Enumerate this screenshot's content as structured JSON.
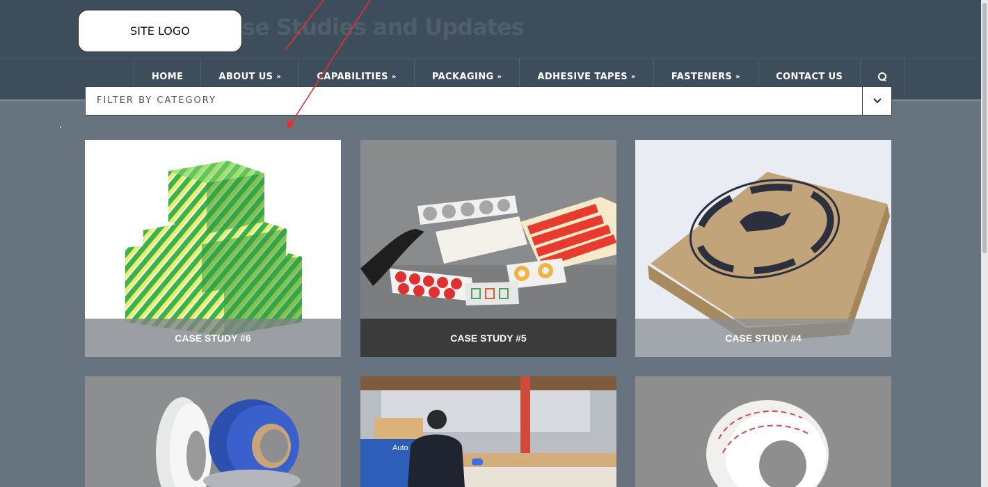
{
  "header": {
    "bg_title": "Case Studies and Updates",
    "logo_text": "SITE LOGO"
  },
  "nav": {
    "items": [
      {
        "label": "HOME",
        "has_dropdown": false
      },
      {
        "label": "ABOUT US",
        "has_dropdown": true
      },
      {
        "label": "CAPABILITIES",
        "has_dropdown": true
      },
      {
        "label": "PACKAGING",
        "has_dropdown": true
      },
      {
        "label": "ADHESIVE TAPES",
        "has_dropdown": true
      },
      {
        "label": "FASTENERS",
        "has_dropdown": true
      },
      {
        "label": "CONTACT US",
        "has_dropdown": false
      }
    ],
    "search_icon": "search-icon",
    "dropdown_icon": "double-chevron-down-icon"
  },
  "filter": {
    "label": "FILTER BY CATEGORY",
    "toggle_icon": "chevron-down-icon"
  },
  "cards": [
    {
      "caption": "CASE STUDY #6",
      "image": "green printed cardboard boxes"
    },
    {
      "caption": "CASE STUDY #5",
      "image": "die-cut adhesive shapes"
    },
    {
      "caption": "CASE STUDY #4",
      "image": "kraft pizza box"
    },
    {
      "caption": "",
      "image": "rolls of tape"
    },
    {
      "caption": "",
      "image": "warehouse worker with box"
    },
    {
      "caption": "",
      "image": "roll of double-sided tape"
    }
  ],
  "colors": {
    "header_bg": "#3e4d5c",
    "page_bg": "#67737f",
    "annotation_arrow": "#e8302a"
  }
}
